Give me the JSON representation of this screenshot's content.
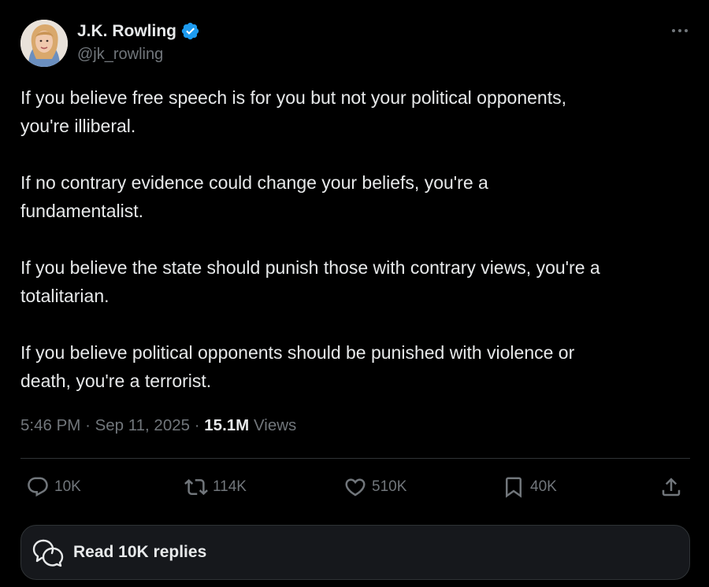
{
  "author": {
    "name": "J.K. Rowling",
    "handle": "@jk_rowling",
    "verified_color": "#1d9bf0"
  },
  "tweet": {
    "paragraphs": [
      "If you believe free speech is for you but not your political opponents,\nyou're illiberal.",
      "If no contrary evidence could change your beliefs, you're a\nfundamentalist.",
      "If you believe the state should punish those with contrary views, you're a\ntotalitarian.",
      "If you believe political opponents should be punished with violence or\ndeath, you're a terrorist."
    ],
    "time": "5:46 PM",
    "date": "Sep 11, 2025",
    "separator": "·",
    "views_count": "15.1M",
    "views_label": "Views"
  },
  "actions": {
    "replies": "10K",
    "reposts": "114K",
    "likes": "510K",
    "bookmarks": "40K"
  },
  "read_replies_label": "Read 10K replies",
  "icons": {
    "more": "more-dots-icon",
    "reply": "reply-bubble-icon",
    "repost": "repost-arrows-icon",
    "like": "heart-icon",
    "bookmark": "bookmark-icon",
    "share": "share-upload-icon",
    "read_replies": "chat-bubbles-icon"
  },
  "colors": {
    "background": "#000000",
    "text": "#e7e9ea",
    "muted": "#71767b",
    "accent": "#1d9bf0"
  }
}
